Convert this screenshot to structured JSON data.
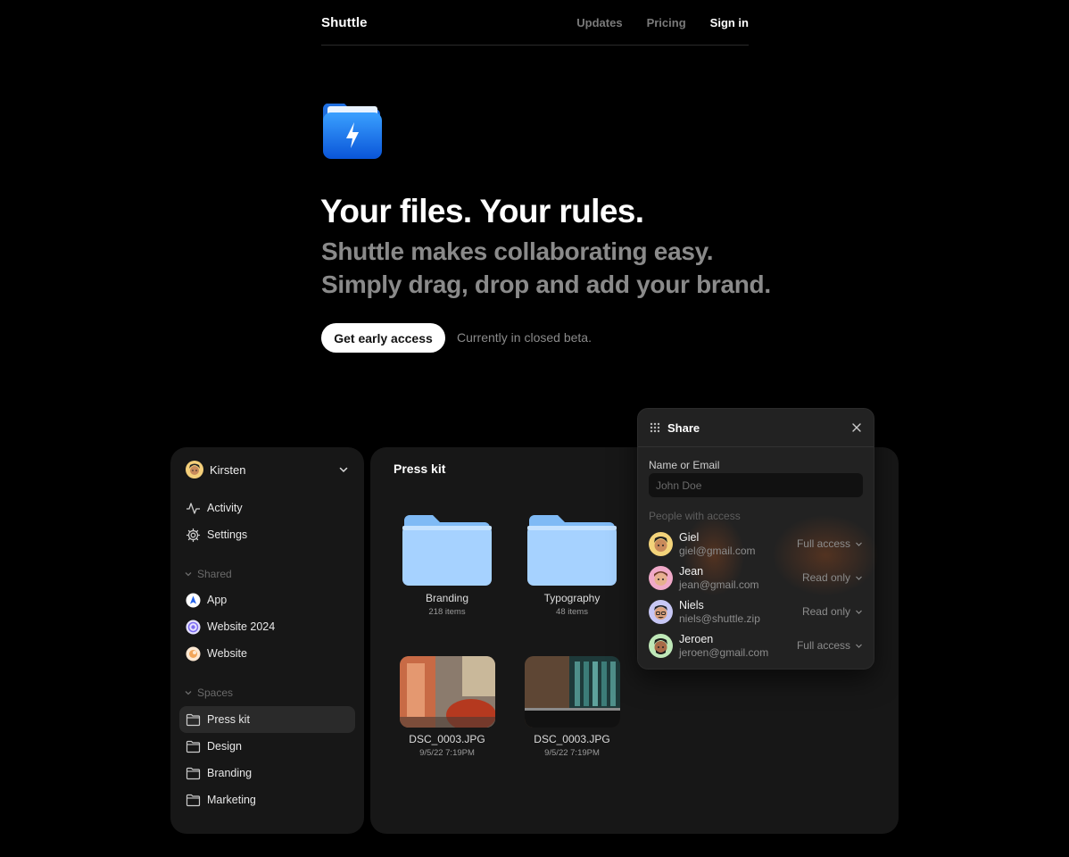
{
  "nav": {
    "brand": "Shuttle",
    "links": [
      "Updates",
      "Pricing",
      "Sign in"
    ]
  },
  "hero": {
    "title": "Your files. Your rules.",
    "subtitle_line1": "Shuttle makes collaborating easy.",
    "subtitle_line2": "Simply drag, drop and add your brand.",
    "cta_label": "Get early access",
    "note": "Currently in closed beta."
  },
  "sidebar": {
    "user_name": "Kirsten",
    "top_items": [
      {
        "label": "Activity",
        "icon": "activity-icon"
      },
      {
        "label": "Settings",
        "icon": "gear-icon"
      }
    ],
    "shared_heading": "Shared",
    "shared_items": [
      {
        "label": "App",
        "color": "#2563eb"
      },
      {
        "label": "Website 2024",
        "color": "#7c6cf2"
      },
      {
        "label": "Website",
        "color": "#f2a65a"
      }
    ],
    "spaces_heading": "Spaces",
    "space_items": [
      {
        "label": "Press kit",
        "selected": true
      },
      {
        "label": "Design",
        "selected": false
      },
      {
        "label": "Branding",
        "selected": false
      },
      {
        "label": "Marketing",
        "selected": false
      }
    ]
  },
  "main": {
    "title": "Press kit",
    "folders": [
      {
        "name": "Branding",
        "meta": "218 items"
      },
      {
        "name": "Typography",
        "meta": "48 items"
      }
    ],
    "files": [
      {
        "name": "DSC_0003.JPG",
        "meta": "9/5/22 7:19PM"
      },
      {
        "name": "DSC_0003.JPG",
        "meta": "9/5/22 7:19PM"
      }
    ]
  },
  "share": {
    "title": "Share",
    "field_label": "Name or Email",
    "field_placeholder": "John Doe",
    "people_label": "People with access",
    "people": [
      {
        "name": "Giel",
        "email": "giel@gmail.com",
        "access": "Full access",
        "color": "#f3d37a"
      },
      {
        "name": "Jean",
        "email": "jean@gmail.com",
        "access": "Read only",
        "color": "#f0a9c8"
      },
      {
        "name": "Niels",
        "email": "niels@shuttle.zip",
        "access": "Read only",
        "color": "#c7c7f5"
      },
      {
        "name": "Jeroen",
        "email": "jeroen@gmail.com",
        "access": "Full access",
        "color": "#bfe8b8"
      }
    ]
  },
  "colors": {
    "background": "#000000",
    "panel": "#171717",
    "popover": "#222222",
    "muted_text": "#8a8a8a",
    "folder_blue": "#9fd0ff",
    "app_icon_blue": "#1a7cf0"
  }
}
